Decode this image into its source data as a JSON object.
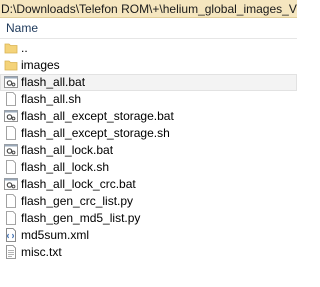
{
  "path": "D:\\Downloads\\Telefon ROM\\+\\helium_global_images_V",
  "header": {
    "name_label": "Name"
  },
  "colors": {
    "path_bar": "#f5e6bf",
    "folder": "#f4d37a",
    "selected_row": "#f3f3f3"
  },
  "files": [
    {
      "name": "..",
      "icon": "folder-icon"
    },
    {
      "name": "images",
      "icon": "folder-icon"
    },
    {
      "name": "flash_all.bat",
      "icon": "gear-script-icon",
      "selected": true
    },
    {
      "name": "flash_all.sh",
      "icon": "blank-file-icon"
    },
    {
      "name": "flash_all_except_storage.bat",
      "icon": "gear-script-icon"
    },
    {
      "name": "flash_all_except_storage.sh",
      "icon": "blank-file-icon"
    },
    {
      "name": "flash_all_lock.bat",
      "icon": "gear-script-icon"
    },
    {
      "name": "flash_all_lock.sh",
      "icon": "blank-file-icon"
    },
    {
      "name": "flash_all_lock_crc.bat",
      "icon": "gear-script-icon"
    },
    {
      "name": "flash_gen_crc_list.py",
      "icon": "blank-file-icon"
    },
    {
      "name": "flash_gen_md5_list.py",
      "icon": "blank-file-icon"
    },
    {
      "name": "md5sum.xml",
      "icon": "xml-file-icon"
    },
    {
      "name": "misc.txt",
      "icon": "text-file-icon"
    }
  ]
}
